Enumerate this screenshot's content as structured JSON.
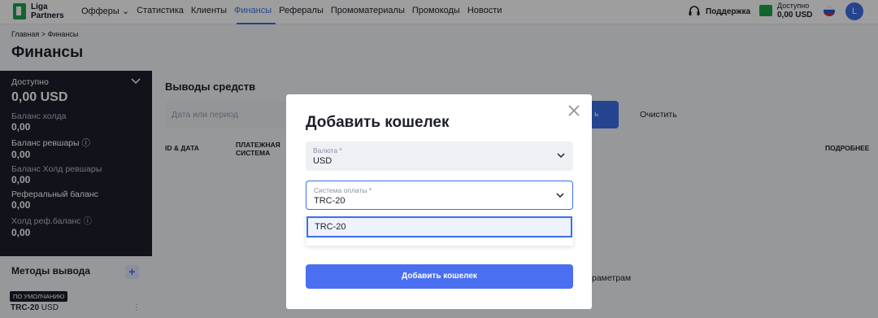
{
  "brand": {
    "line1": "Liga",
    "line2": "Partners"
  },
  "nav": {
    "items": [
      "Офферы",
      "Статистика",
      "Клиенты",
      "Финансы",
      "Рефералы",
      "Промоматериалы",
      "Промокоды",
      "Новости"
    ],
    "offers_chevron": "⌄",
    "support": "Поддержка",
    "balance_label": "Доступно",
    "balance_value": "0,00 USD",
    "avatar_letter": "L"
  },
  "breadcrumb": {
    "home": "Главная",
    "separator": ">",
    "current": "Финансы"
  },
  "page_title": "Финансы",
  "sidebar": {
    "available_label": "Доступно",
    "available_value": "0,00 USD",
    "rows": [
      {
        "label": "Баланс холда",
        "value": "0,00"
      },
      {
        "label": "Баланс ревшары ⓘ",
        "value": "0,00"
      },
      {
        "label": "Баланс Холд ревшары",
        "value": "0,00"
      },
      {
        "label": "Реферальный баланс",
        "value": "0,00"
      },
      {
        "label": "Холд реф.баланс ⓘ",
        "value": "0,00"
      }
    ],
    "methods_title": "Методы вывода",
    "add": "+",
    "default_badge": "ПО УМОЛЧАНИЮ",
    "method_name": "TRC-20",
    "method_currency": "USD"
  },
  "main": {
    "title": "Выводы средств",
    "date_placeholder": "Дата или период",
    "apply_partial": "ь",
    "clear": "Очистить",
    "columns": [
      "ID & ДАТА",
      "ПЛАТЕЖНАЯ СИСТЕМА",
      "ПОДРОБНЕЕ"
    ],
    "empty_partial": "раметрам"
  },
  "modal": {
    "title": "Добавить кошелек",
    "currency_label": "Валюта *",
    "currency_value": "USD",
    "payment_label": "Система оплаты *",
    "payment_value": "TRC-20",
    "options": [
      "TRC-20"
    ],
    "submit": "Добавить кошелек"
  },
  "colors": {
    "accent": "#3d6fe8",
    "sidebar": "#1d1f2b",
    "brand_green": "#1aa34a"
  }
}
